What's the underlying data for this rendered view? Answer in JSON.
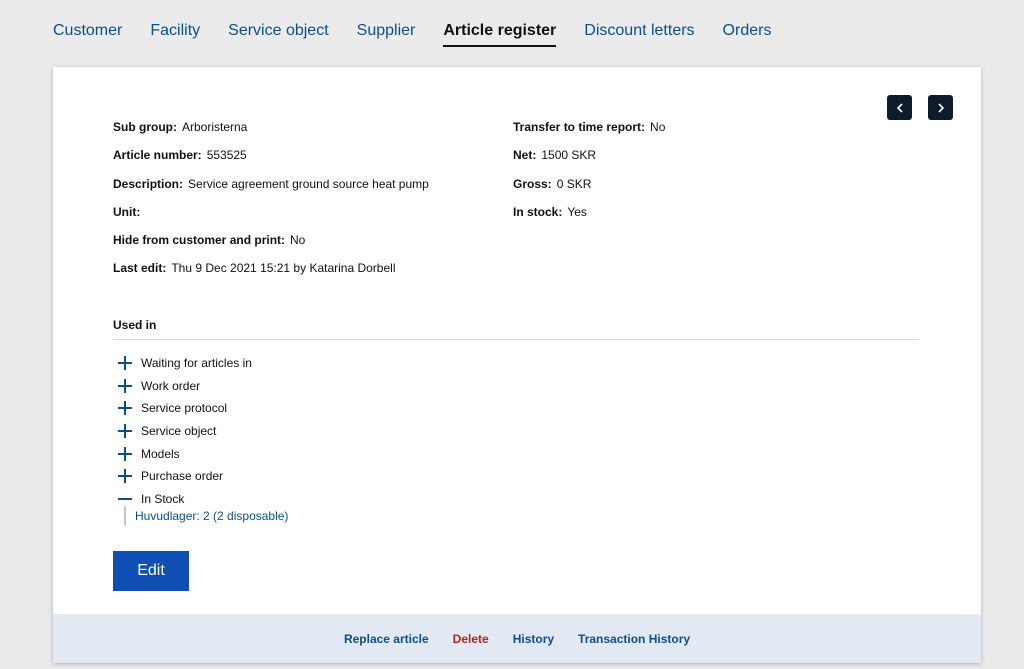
{
  "tabs": [
    {
      "label": "Customer",
      "active": false
    },
    {
      "label": "Facility",
      "active": false
    },
    {
      "label": "Service object",
      "active": false
    },
    {
      "label": "Supplier",
      "active": false
    },
    {
      "label": "Article register",
      "active": true
    },
    {
      "label": "Discount letters",
      "active": false
    },
    {
      "label": "Orders",
      "active": false
    }
  ],
  "details": {
    "left": [
      {
        "label": "Sub group:",
        "value": "Arboristerna"
      },
      {
        "label": "Article number:",
        "value": "553525"
      },
      {
        "label": "Description:",
        "value": "Service agreement ground source heat pump"
      },
      {
        "label": "Unit:",
        "value": ""
      },
      {
        "label": "Hide from customer and print:",
        "value": "No"
      },
      {
        "label": "Last edit:",
        "value": "Thu 9 Dec 2021 15:21 by Katarina Dorbell"
      }
    ],
    "right": [
      {
        "label": "Transfer to time report:",
        "value": "No"
      },
      {
        "label": "Net:",
        "value": "1500 SKR"
      },
      {
        "label": "Gross:",
        "value": "0 SKR"
      },
      {
        "label": "In stock:",
        "value": "Yes"
      }
    ]
  },
  "used_in": {
    "title": "Used in",
    "items": [
      {
        "label": "Waiting for articles in",
        "expanded": false
      },
      {
        "label": "Work order",
        "expanded": false
      },
      {
        "label": "Service protocol",
        "expanded": false
      },
      {
        "label": "Service object",
        "expanded": false
      },
      {
        "label": "Models",
        "expanded": false
      },
      {
        "label": "Purchase order",
        "expanded": false
      },
      {
        "label": "In Stock",
        "expanded": true
      }
    ],
    "stock_entry": "Huvudlager: 2 (2 disposable)"
  },
  "actions": {
    "edit_label": "Edit"
  },
  "footer": {
    "links": [
      {
        "label": "Replace article"
      },
      {
        "label": "Delete"
      },
      {
        "label": "History"
      },
      {
        "label": "Transaction History"
      }
    ]
  },
  "colors": {
    "link": "#0b4e8c",
    "primary": "#0f4fb3",
    "danger": "#b3261e",
    "nav_button": "#0d1b2a",
    "footer_bg": "#e3e9f2"
  },
  "icons": {
    "prev": "chevron-left-icon",
    "next": "chevron-right-icon",
    "expand": "plus-icon",
    "collapse": "minus-icon"
  }
}
